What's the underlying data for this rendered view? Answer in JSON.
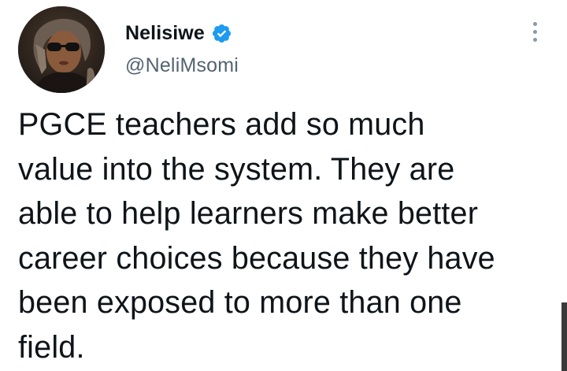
{
  "author": {
    "display_name": "Nelisiwe",
    "handle": "@NeliMsomi",
    "verified": true,
    "verified_icon": "verified-badge-icon",
    "avatar_icon": "profile-avatar"
  },
  "tweet": {
    "text": "PGCE teachers add so much\nvalue into the system. They are\nable to help learners make better\ncareer choices because they have\nbeen exposed to more than one\nfield."
  },
  "menu": {
    "icon": "more-vertical-icon"
  },
  "colors": {
    "text_primary": "#0f1419",
    "text_secondary": "#536471",
    "verified_blue": "#1d9bf0",
    "background": "#ffffff"
  }
}
